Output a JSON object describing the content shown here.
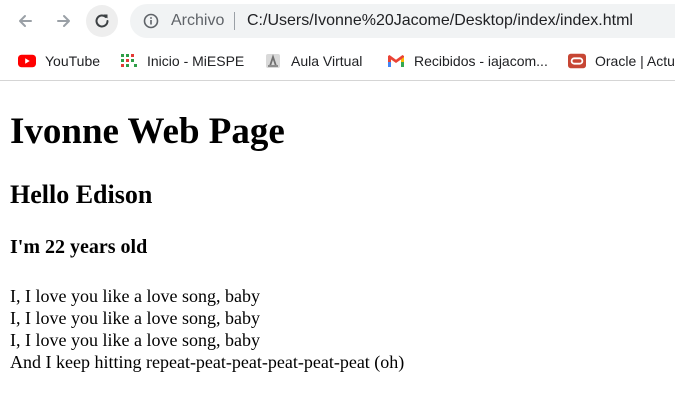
{
  "browser": {
    "scheme_label": "Archivo",
    "url": "C:/Users/Ivonne%20Jacome/Desktop/index/index.html",
    "nav_icons": [
      "arrow-back-icon",
      "arrow-forward-icon",
      "reload-icon",
      "info-icon"
    ]
  },
  "bookmarks": [
    {
      "label": "YouTube",
      "icon": "youtube-icon"
    },
    {
      "label": "Inicio - MiESPE",
      "icon": "miespe-icon"
    },
    {
      "label": "Aula Virtual",
      "icon": "aula-virtual-icon"
    },
    {
      "label": "Recibidos - iajacom...",
      "icon": "gmail-icon"
    },
    {
      "label": "Oracle | Actu",
      "icon": "oracle-icon"
    }
  ],
  "page": {
    "title": "Ivonne Web Page",
    "greeting": "Hello Edison",
    "age": "I'm 22 years old",
    "lyrics": [
      "I, I love you like a love song, baby",
      "I, I love you like a love song, baby",
      "I, I love you like a love song, baby",
      "And I keep hitting repeat-peat-peat-peat-peat-peat (oh)"
    ]
  },
  "colors": {
    "youtube_red": "#ff0000",
    "gmail_red": "#ea4335",
    "oracle_red": "#c74634",
    "miespe_green": "#2e9e47",
    "omnibox_bg": "#f1f3f4"
  }
}
